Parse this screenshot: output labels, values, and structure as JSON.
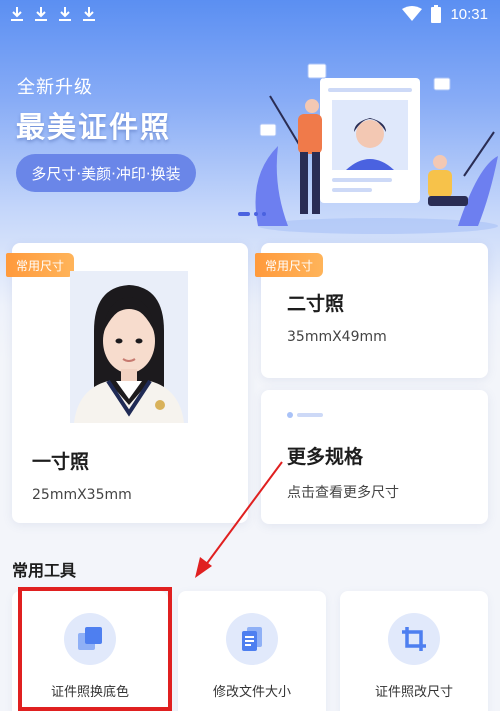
{
  "status_bar": {
    "time": "10:31"
  },
  "hero": {
    "subtitle": "全新升级",
    "title": "最美证件照",
    "pill": "多尺寸·美颜·冲印·换装"
  },
  "cards": {
    "one_inch": {
      "tag": "常用尺寸",
      "title": "一寸照",
      "size": "25mmX35mm"
    },
    "two_inch": {
      "tag": "常用尺寸",
      "title": "二寸照",
      "size": "35mmX49mm"
    },
    "more": {
      "title": "更多规格",
      "desc": "点击查看更多尺寸"
    }
  },
  "tools": {
    "section_title": "常用工具",
    "items": [
      {
        "label": "证件照换底色",
        "icon": "layers-icon"
      },
      {
        "label": "修改文件大小",
        "icon": "document-icon"
      },
      {
        "label": "证件照改尺寸",
        "icon": "crop-icon"
      }
    ]
  },
  "colors": {
    "accent": "#5b8ff2",
    "tag_orange": "#ff9a3c",
    "highlight_red": "#e02020",
    "icon_bg": "#e1e9fb"
  }
}
